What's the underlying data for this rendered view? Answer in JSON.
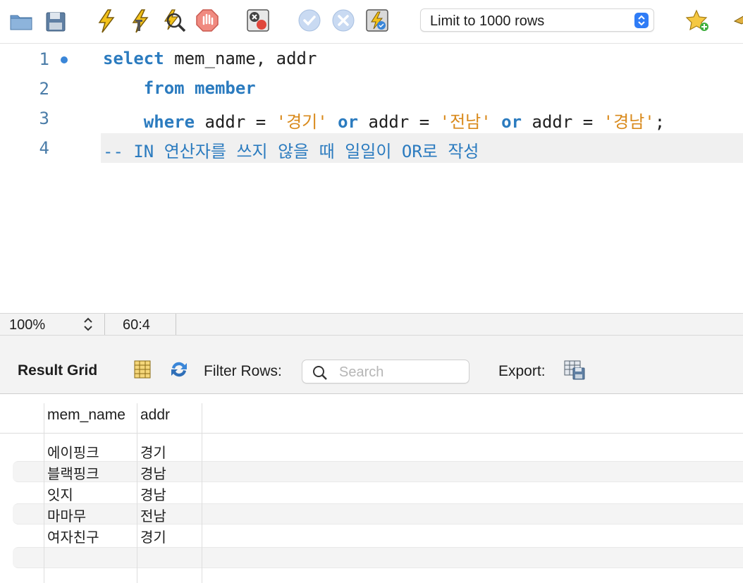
{
  "toolbar": {
    "icons": [
      "open-folder-icon",
      "save-icon",
      "execute-icon",
      "execute-statement-icon",
      "explain-icon",
      "stop-icon",
      "toggle-error-icon",
      "commit-icon",
      "rollback-icon",
      "autocommit-icon",
      "bookmark-star-icon",
      "beautify-icon"
    ],
    "limit_select_value": "Limit to 1000 rows"
  },
  "editor": {
    "lines": [
      {
        "number": "1",
        "text": "select mem_name, addr"
      },
      {
        "number": "2",
        "text": "from member"
      },
      {
        "number": "3",
        "text": "where addr = '경기' or addr = '전남' or addr = '경남';"
      },
      {
        "number": "4",
        "text": "-- IN 연산자를 쓰지 않을 때 일일이 OR로 작성"
      }
    ],
    "tokens": {
      "select": "select",
      "l1_rest": " mem_name, addr",
      "from": "from",
      "member": "member",
      "where": "where",
      "addr_eq": " addr = ",
      "or": "or",
      "s1": "'경기'",
      "s2": "'전남'",
      "s3": "'경남'",
      "semi": ";",
      "comment": "-- IN 연산자를 쓰지 않을 때 일일이 OR로 작성"
    }
  },
  "status": {
    "zoom": "100%",
    "cursor": "60:4"
  },
  "result": {
    "title": "Result Grid",
    "filter_label": "Filter Rows:",
    "search_placeholder": "Search",
    "export_label": "Export:",
    "columns": [
      "mem_name",
      "addr"
    ],
    "rows": [
      [
        "에이핑크",
        "경기"
      ],
      [
        "블랙핑크",
        "경남"
      ],
      [
        "잇지",
        "경남"
      ],
      [
        "마마무",
        "전남"
      ],
      [
        "여자친구",
        "경기"
      ]
    ]
  },
  "colors": {
    "keyword": "#2b7bbf",
    "string": "#d98a1c",
    "accent": "#2f7cf6"
  }
}
